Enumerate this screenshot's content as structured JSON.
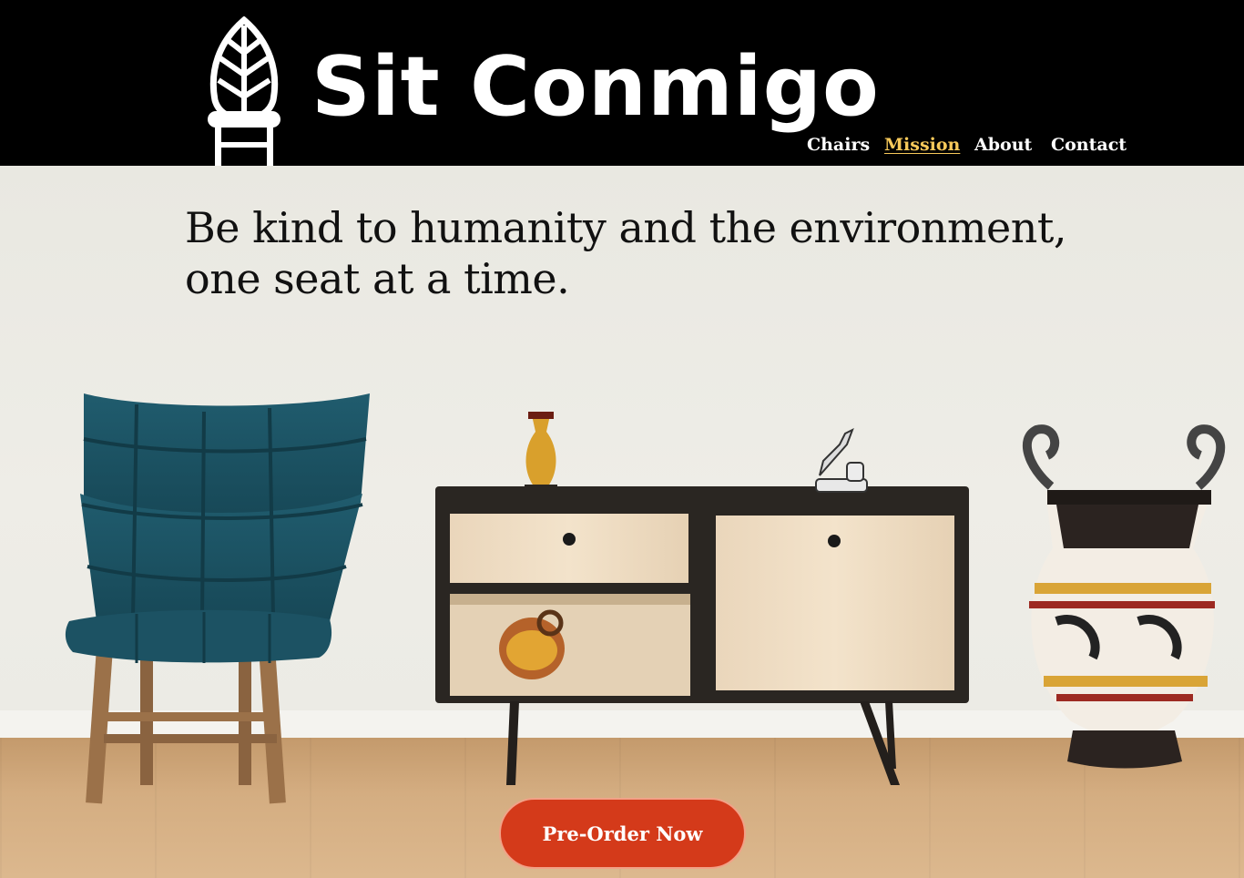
{
  "brand": {
    "name": "Sit Conmigo",
    "logo_icon": "chair-leaf-icon"
  },
  "nav": {
    "items": [
      {
        "label": "Chairs",
        "active": false
      },
      {
        "label": "Mission",
        "active": true
      },
      {
        "label": "About",
        "active": false
      },
      {
        "label": "Contact",
        "active": false
      }
    ],
    "active_color": "#f7c95a"
  },
  "hero": {
    "tagline_line1": "Be kind to humanity and the environment,",
    "tagline_line2": "one seat at a time.",
    "cta_label": "Pre-Order Now",
    "cta_color": "#d43a1a"
  },
  "colors": {
    "header_bg": "#000000",
    "chair": "#1f5768",
    "sideboard": "#2a2622"
  }
}
